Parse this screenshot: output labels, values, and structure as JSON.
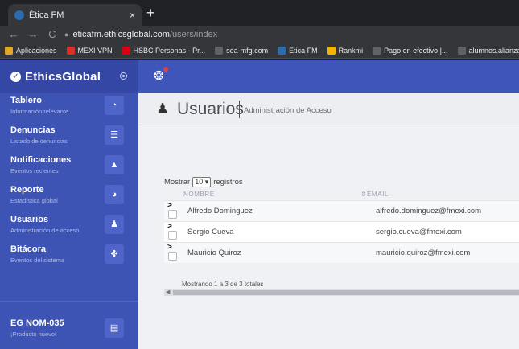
{
  "browser": {
    "tab_title": "Ética FM",
    "tab_close": "×",
    "new_tab": "+",
    "nav_back": "←",
    "nav_forward": "→",
    "nav_reload": "C",
    "url_host": "eticafm.ethicsglobal.com",
    "url_path": "/users/index",
    "bookmarks": [
      {
        "label": "Aplicaciones",
        "icon": "apps-grid-icon",
        "color": "#e0a72e"
      },
      {
        "label": "MEXI VPN",
        "icon": "vpn-icon",
        "color": "#d93025"
      },
      {
        "label": "HSBC Personas - Pr...",
        "icon": "hsbc-icon",
        "color": "#db0011"
      },
      {
        "label": "sea-mfg.com",
        "icon": "globe-icon",
        "color": "#5f6368"
      },
      {
        "label": "Ética FM",
        "icon": "ethics-icon",
        "color": "#2b6cb0"
      },
      {
        "label": "Rankmi",
        "icon": "rankmi-icon",
        "color": "#f4b400"
      },
      {
        "label": "Pago en efectivo |...",
        "icon": "card-icon",
        "color": "#5f6368"
      },
      {
        "label": "alumnos.alianzafran...",
        "icon": "globe-icon",
        "color": "#5f6368"
      }
    ]
  },
  "brand": {
    "name": "EthicsGlobal"
  },
  "sidebar": {
    "items": [
      {
        "title": "Tablero",
        "subtitle": "Información relevante",
        "icon": "dashboard-icon",
        "glyph": "◔"
      },
      {
        "title": "Denuncias",
        "subtitle": "Listado de denuncias",
        "icon": "list-icon",
        "glyph": "☰"
      },
      {
        "title": "Notificaciones",
        "subtitle": "Eventos recientes",
        "icon": "bell-icon",
        "glyph": "▲"
      },
      {
        "title": "Reporte",
        "subtitle": "Estadística global",
        "icon": "pie-chart-icon",
        "glyph": "◕"
      },
      {
        "title": "Usuarios",
        "subtitle": "Administración de acceso",
        "icon": "users-icon",
        "glyph": "♟"
      },
      {
        "title": "Bitácora",
        "subtitle": "Eventos del sistema",
        "icon": "paw-icon",
        "glyph": "✤"
      },
      {
        "title": "EG NOM-035",
        "subtitle": "¡Producto nuevo!",
        "icon": "id-card-icon",
        "glyph": "▤"
      }
    ]
  },
  "page": {
    "title": "Usuarios",
    "subtitle": "Administración de Acceso",
    "icon_glyph": "♟"
  },
  "table": {
    "show_prefix": "Mostrar",
    "page_length": "10 ▾",
    "show_suffix": "registros",
    "columns": [
      "NOMBRE",
      "EMAIL"
    ],
    "rows": [
      {
        "name": "Alfredo Dominguez",
        "email": "alfredo.dominguez@fmexi.com"
      },
      {
        "name": "Sergio Cueva",
        "email": "sergio.cueva@fmexi.com"
      },
      {
        "name": "Mauricio Quiroz",
        "email": "mauricio.quiroz@fmexi.com"
      }
    ],
    "info": "Mostrando 1 a 3 de 3 totales"
  }
}
